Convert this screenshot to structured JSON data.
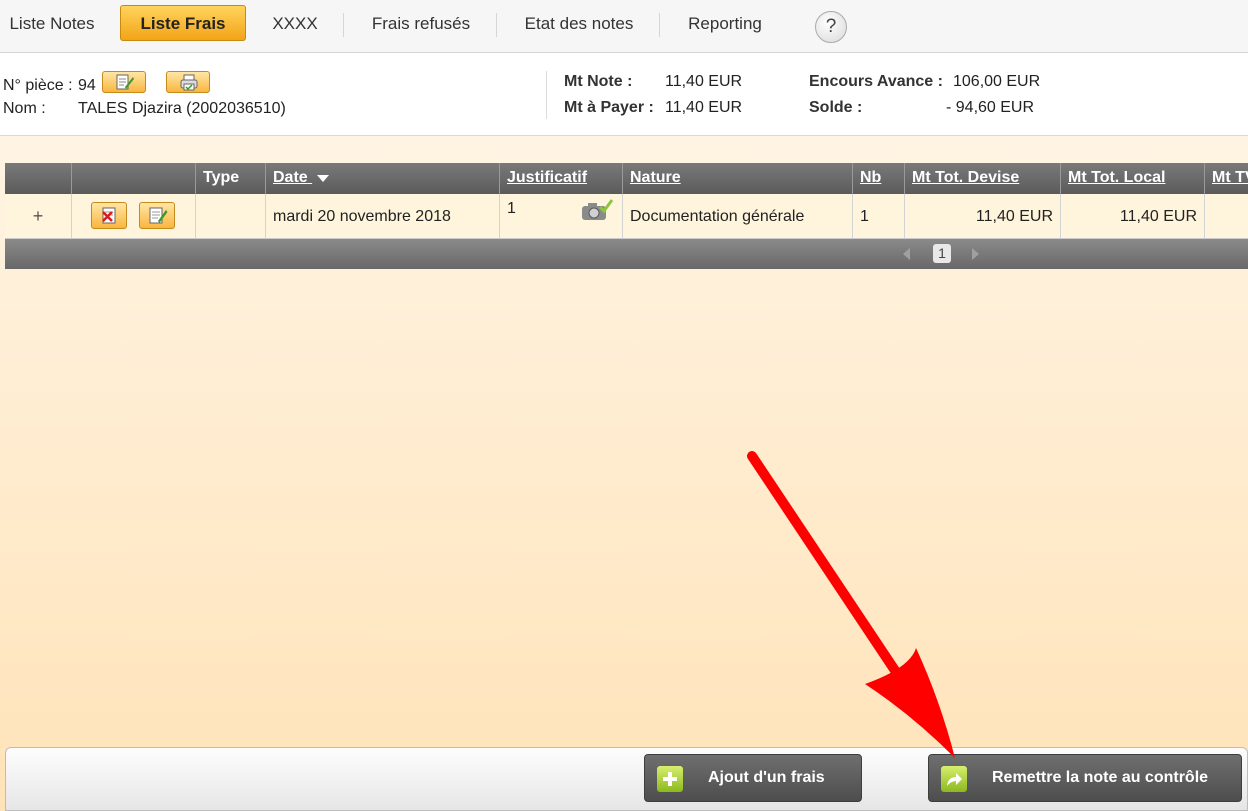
{
  "nav": {
    "items": [
      {
        "label": "Liste Notes"
      },
      {
        "label": "Liste Frais"
      },
      {
        "label": "XXXX"
      },
      {
        "label": "Frais refusés"
      },
      {
        "label": "Etat des notes"
      },
      {
        "label": "Reporting"
      }
    ],
    "help_label": "?"
  },
  "info": {
    "piece_label": "N° pièce :",
    "piece_value": "94",
    "nom_label": "Nom :",
    "nom_value": "TALES Djazira (2002036510)",
    "mt_note_label": "Mt Note :",
    "mt_note_value": "11,40 EUR",
    "mt_payer_label": "Mt à Payer :",
    "mt_payer_value": "11,40 EUR",
    "encours_label": "Encours Avance :",
    "encours_value": "106,00 EUR",
    "solde_label": "Solde :",
    "solde_value": "-  94,60 EUR"
  },
  "grid": {
    "columns": [
      "Type",
      "Date",
      "Justificatif",
      "Nature",
      "Nb",
      "Mt Tot. Devise",
      "Mt Tot. Local",
      "Mt TV"
    ],
    "rows": [
      {
        "expand": "+",
        "type": "",
        "date": "mardi 20 novembre 2018",
        "justificatif": "1",
        "nature": "Documentation générale",
        "nb": "1",
        "mt_devise": "11,40 EUR",
        "mt_local": "11,40 EUR"
      }
    ],
    "pager": {
      "current_page": "1"
    }
  },
  "actions": {
    "add_label": "Ajout d'un frais",
    "submit_label": "Remettre la note au contrôle"
  },
  "colors": {
    "accent_orange": "#f3a417",
    "header_grey": "#5b5b5b",
    "annotation_red": "#ff0000"
  }
}
